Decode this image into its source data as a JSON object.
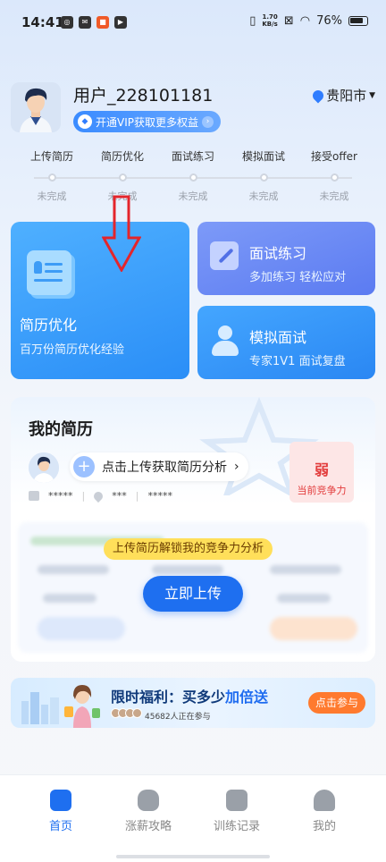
{
  "status_bar": {
    "time": "14:41",
    "net_speed_value": "1.70",
    "net_speed_unit": "KB/s",
    "battery": "76%"
  },
  "profile": {
    "username": "用户_228101181",
    "vip_text": "开通VIP获取更多权益",
    "city": "贵阳市"
  },
  "steps": [
    {
      "label": "上传简历",
      "status": "未完成"
    },
    {
      "label": "简历优化",
      "status": "未完成"
    },
    {
      "label": "面试练习",
      "status": "未完成"
    },
    {
      "label": "模拟面试",
      "status": "未完成"
    },
    {
      "label": "接受offer",
      "status": "未完成"
    }
  ],
  "cards": {
    "resume_opt": {
      "title": "简历优化",
      "subtitle": "百万份简历优化经验"
    },
    "interview_practice": {
      "title": "面试练习",
      "subtitle": "多加练习 轻松应对"
    },
    "mock_interview": {
      "title": "模拟面试",
      "subtitle": "专家1V1 面试复盘"
    }
  },
  "resume": {
    "title": "我的简历",
    "upload_prompt": "点击上传获取简历分析",
    "masked": [
      "*****",
      "***",
      "*****"
    ],
    "compete_level": "弱",
    "compete_label": "当前竞争力",
    "unlock_text": "上传简历解锁我的竞争力分析",
    "upload_button": "立即上传"
  },
  "banner": {
    "title_prefix": "限时福利：买多少",
    "title_accent": "加倍送",
    "participants": "45682人正在参与",
    "button": "点击参与"
  },
  "bottom_nav": [
    {
      "label": "首页",
      "icon": "home-icon",
      "active": true
    },
    {
      "label": "涨薪攻略",
      "icon": "money-bag-icon",
      "active": false
    },
    {
      "label": "训练记录",
      "icon": "briefcase-icon",
      "active": false
    },
    {
      "label": "我的",
      "icon": "user-icon",
      "active": false
    }
  ],
  "colors": {
    "accent": "#1e6ff0",
    "warning": "#e23b3b",
    "promo": "#ff7a2e"
  }
}
